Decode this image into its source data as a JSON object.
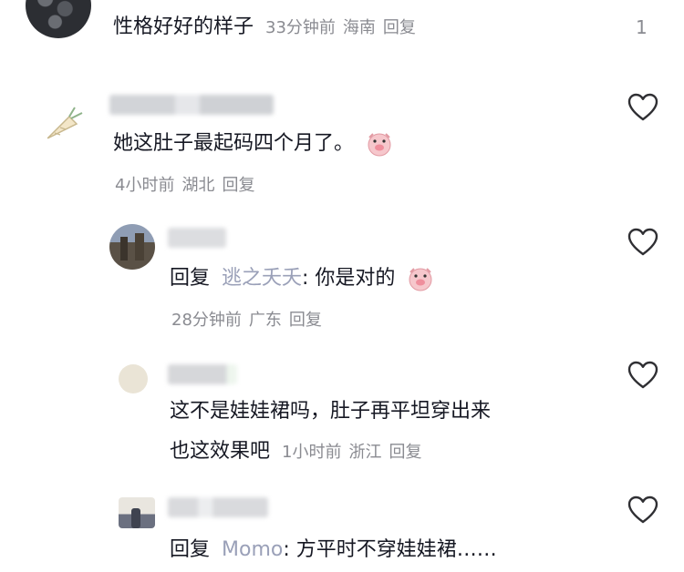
{
  "comments": [
    {
      "text": "性格好好的样子",
      "time": "33分钟前",
      "location": "海南",
      "reply_label": "回复",
      "likes": "1"
    },
    {
      "text": "她这肚子最起码四个月了。",
      "time": "4小时前",
      "location": "湖北",
      "reply_label": "回复",
      "replies": [
        {
          "prefix": "回复",
          "mention": "逃之夭夭",
          "text": ": 你是对的",
          "time": "28分钟前",
          "location": "广东",
          "reply_label": "回复"
        },
        {
          "text_line1": "这不是娃娃裙吗，肚子再平坦穿出来",
          "text_line2": "也这效果吧",
          "time": "1小时前",
          "location": "浙江",
          "reply_label": "回复"
        },
        {
          "prefix": "回复",
          "mention": "Momo",
          "text": ": 方平时不穿娃娃裙……"
        }
      ]
    }
  ],
  "icons": {
    "like": "heart-outline-icon",
    "emoji": "pig-face-emoji-icon"
  },
  "colors": {
    "meta": "#8a8b91",
    "mention": "#9aa0b8",
    "heart": "#2f2f33"
  }
}
